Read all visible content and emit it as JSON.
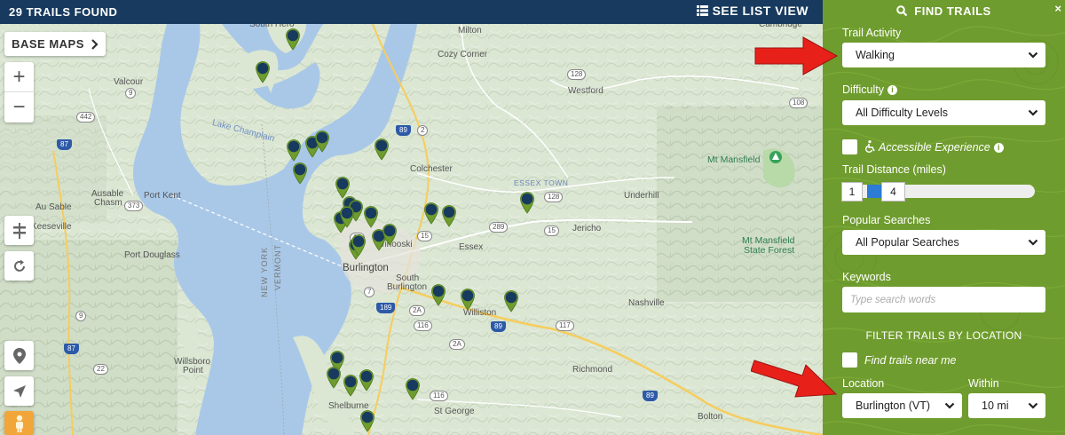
{
  "topbar": {
    "trails_found": "29 TRAILS FOUND",
    "see_list_view": "SEE LIST VIEW"
  },
  "map_controls": {
    "base_maps": "BASE MAPS",
    "zoom_in": "+",
    "zoom_out": "−"
  },
  "map_labels": {
    "lake": "Lake Champlain",
    "burlington": "Burlington",
    "colchester": "Colchester",
    "essex": "Essex",
    "essex_town": "ESSEX TOWN",
    "south_burlington_1": "South",
    "south_burlington_2": "Burlington",
    "williston": "Williston",
    "shelburne": "Shelburne",
    "st_george": "St George",
    "richmond": "Richmond",
    "nashville": "Nashville",
    "jericho": "Jericho",
    "underhill": "Underhill",
    "westford": "Westford",
    "milton": "Milton",
    "cozy_corner": "Cozy Corner",
    "valcour": "Valcour",
    "port_kent": "Port Kent",
    "ausable_chasm_1": "Ausable",
    "ausable_chasm_2": "Chasm",
    "au_sable": "Au Sable",
    "keeseville": "Keeseville",
    "port_douglass": "Port Douglass",
    "willsboro_1": "Willsboro",
    "willsboro_2": "Point",
    "mt_mansfield": "Mt Mansfield",
    "mt_mansfield_sf_1": "Mt Mansfield",
    "mt_mansfield_sf_2": "State Forest",
    "bolton": "Bolton",
    "winooski": "Winooski",
    "south_hero": "South Hero",
    "cambridge": "Cambridge",
    "vermont": "VERMONT",
    "new_york": "NEW YORK",
    "route_shields": [
      "9",
      "442",
      "87",
      "373",
      "9",
      "87",
      "22",
      "89",
      "2",
      "15",
      "128",
      "289",
      "15",
      "15",
      "7",
      "189",
      "116",
      "2A",
      "89",
      "117",
      "2A",
      "89",
      "116",
      "108",
      "128"
    ]
  },
  "panel": {
    "title": "FIND TRAILS",
    "close": "×",
    "trail_activity_label": "Trail Activity",
    "trail_activity_value": "Walking",
    "difficulty_label": "Difficulty",
    "difficulty_value": "All Difficulty Levels",
    "accessible_label": "Accessible Experience",
    "accessible_checked": false,
    "distance_label": "Trail Distance (miles)",
    "distance_min": "1",
    "distance_max": "4",
    "popular_label": "Popular Searches",
    "popular_value": "All Popular Searches",
    "keywords_label": "Keywords",
    "keywords_placeholder": "Type search words",
    "filter_location_heading": "FILTER TRAILS BY LOCATION",
    "near_me_label": "Find trails near me",
    "near_me_checked": false,
    "location_label": "Location",
    "location_value": "Burlington (VT)",
    "within_label": "Within",
    "within_value": "10 mi"
  },
  "colors": {
    "topbar": "#173a5e",
    "panel": "#6f9c2e",
    "marker_head": "#173a5e",
    "marker_tail": "#6f9c2e",
    "annotation_arrow": "#e8201a"
  }
}
